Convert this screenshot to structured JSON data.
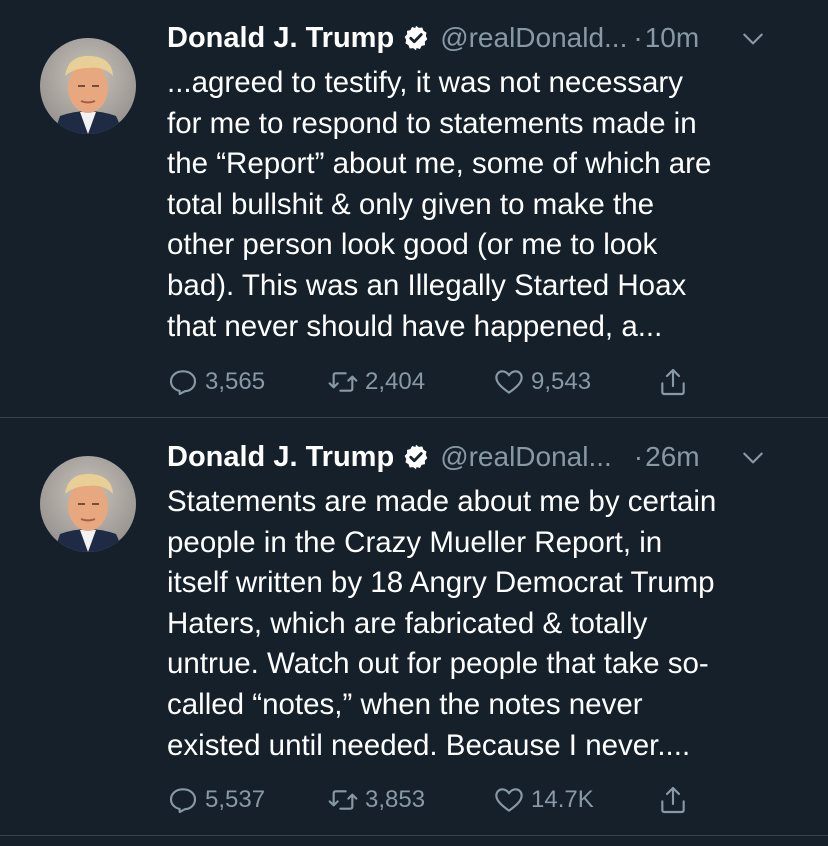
{
  "tweets": [
    {
      "author_name": "Donald J. Trump",
      "handle": "@realDonald...",
      "dot": "·",
      "time": "10m",
      "lines": [
        "...agreed to testify, it was not necessary",
        "for me to respond to statements made in",
        "the “Report” about me, some of which are",
        "total bullshit & only given to make the",
        "other person look good (or me to look",
        "bad). This was an Illegally Started Hoax",
        "that never should have happened, a..."
      ],
      "replies": "3,565",
      "retweets": "2,404",
      "likes": "9,543"
    },
    {
      "author_name": "Donald J. Trump",
      "handle": "@realDonal...",
      "dot": "·",
      "time": "26m",
      "lines": [
        "Statements are made about me by certain",
        "people in the Crazy Mueller Report, in",
        "itself written by 18 Angry Democrat Trump",
        "Haters, which are fabricated & totally",
        "untrue. Watch out for people that take so-",
        "called “notes,” when the notes never",
        "existed until needed. Because I never...."
      ],
      "replies": "5,537",
      "retweets": "3,853",
      "likes": "14.7K"
    }
  ],
  "icons": {
    "verified": "verified-badge-icon",
    "caret": "chevron-down-icon",
    "reply": "reply-icon",
    "retweet": "retweet-icon",
    "like": "heart-icon",
    "share": "share-icon"
  },
  "colors": {
    "background": "#15202b",
    "text": "#ffffff",
    "secondary": "#8899a6",
    "divider": "#38444d"
  }
}
